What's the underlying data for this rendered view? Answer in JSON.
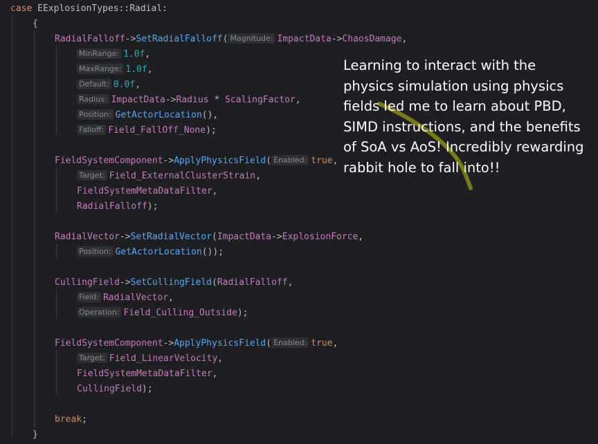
{
  "colors": {
    "background": "#1e1f22",
    "keyword": "#cf8e6d",
    "type": "#bcbec4",
    "field": "#c77dbb",
    "method": "#56a8f5",
    "number": "#2aacb8",
    "text": "#bcbec4",
    "hint_bg": "#2f3034",
    "hint_text": "#868a91",
    "overlay_text": "#ffffff"
  },
  "code_lines": [
    {
      "indent": 0,
      "tokens": [
        {
          "t": "case",
          "c": "kw"
        },
        {
          "t": " EExplosionTypes::Radial:",
          "c": "tx"
        }
      ]
    },
    {
      "indent": 1,
      "tokens": [
        {
          "t": "{",
          "c": "tx"
        }
      ]
    },
    {
      "indent": 2,
      "tokens": [
        {
          "t": "RadialFalloff",
          "c": "fl"
        },
        {
          "t": "->",
          "c": "tx"
        },
        {
          "t": "SetRadialFalloff",
          "c": "me"
        },
        {
          "t": "(",
          "c": "tx"
        },
        {
          "t": "Magnitude:",
          "c": "hint"
        },
        {
          "t": "ImpactData",
          "c": "fl"
        },
        {
          "t": "->",
          "c": "tx"
        },
        {
          "t": "ChaosDamage",
          "c": "fl"
        },
        {
          "t": ",",
          "c": "tx"
        }
      ]
    },
    {
      "indent": 3,
      "tokens": [
        {
          "t": "MinRange:",
          "c": "hint"
        },
        {
          "t": "1.0f",
          "c": "nu"
        },
        {
          "t": ",",
          "c": "tx"
        }
      ]
    },
    {
      "indent": 3,
      "tokens": [
        {
          "t": "MaxRange:",
          "c": "hint"
        },
        {
          "t": "1.0f",
          "c": "nu"
        },
        {
          "t": ",",
          "c": "tx"
        }
      ]
    },
    {
      "indent": 3,
      "tokens": [
        {
          "t": "Default:",
          "c": "hint"
        },
        {
          "t": "0.0f",
          "c": "nu"
        },
        {
          "t": ",",
          "c": "tx"
        }
      ]
    },
    {
      "indent": 3,
      "tokens": [
        {
          "t": "Radius:",
          "c": "hint"
        },
        {
          "t": "ImpactData",
          "c": "fl"
        },
        {
          "t": "->",
          "c": "tx"
        },
        {
          "t": "Radius",
          "c": "fl"
        },
        {
          "t": " * ",
          "c": "tx"
        },
        {
          "t": "ScalingFactor",
          "c": "fl"
        },
        {
          "t": ",",
          "c": "tx"
        }
      ]
    },
    {
      "indent": 3,
      "tokens": [
        {
          "t": "Position:",
          "c": "hint"
        },
        {
          "t": "GetActorLocation",
          "c": "me"
        },
        {
          "t": "(),",
          "c": "tx"
        }
      ]
    },
    {
      "indent": 3,
      "tokens": [
        {
          "t": "Falloff:",
          "c": "hint"
        },
        {
          "t": "Field_FallOff_None",
          "c": "fl"
        },
        {
          "t": ");",
          "c": "tx"
        }
      ]
    },
    {
      "indent": 0,
      "tokens": []
    },
    {
      "indent": 2,
      "tokens": [
        {
          "t": "FieldSystemComponent",
          "c": "fl"
        },
        {
          "t": "->",
          "c": "tx"
        },
        {
          "t": "ApplyPhysicsField",
          "c": "me"
        },
        {
          "t": "(",
          "c": "tx"
        },
        {
          "t": "Enabled:",
          "c": "hint"
        },
        {
          "t": "true",
          "c": "kw"
        },
        {
          "t": ",",
          "c": "tx"
        }
      ]
    },
    {
      "indent": 3,
      "tokens": [
        {
          "t": "Target:",
          "c": "hint"
        },
        {
          "t": "Field_ExternalClusterStrain",
          "c": "fl"
        },
        {
          "t": ",",
          "c": "tx"
        }
      ]
    },
    {
      "indent": 3,
      "tokens": [
        {
          "t": "FieldSystemMetaDataFilter",
          "c": "fl"
        },
        {
          "t": ",",
          "c": "tx"
        }
      ]
    },
    {
      "indent": 3,
      "tokens": [
        {
          "t": "RadialFalloff",
          "c": "fl"
        },
        {
          "t": ");",
          "c": "tx"
        }
      ]
    },
    {
      "indent": 0,
      "tokens": []
    },
    {
      "indent": 2,
      "tokens": [
        {
          "t": "RadialVector",
          "c": "fl"
        },
        {
          "t": "->",
          "c": "tx"
        },
        {
          "t": "SetRadialVector",
          "c": "me"
        },
        {
          "t": "(",
          "c": "tx"
        },
        {
          "t": "ImpactData",
          "c": "fl"
        },
        {
          "t": "->",
          "c": "tx"
        },
        {
          "t": "ExplosionForce",
          "c": "fl"
        },
        {
          "t": ",",
          "c": "tx"
        }
      ]
    },
    {
      "indent": 3,
      "tokens": [
        {
          "t": "Position:",
          "c": "hint"
        },
        {
          "t": "GetActorLocation",
          "c": "me"
        },
        {
          "t": "());",
          "c": "tx"
        }
      ]
    },
    {
      "indent": 0,
      "tokens": []
    },
    {
      "indent": 2,
      "tokens": [
        {
          "t": "CullingField",
          "c": "fl"
        },
        {
          "t": "->",
          "c": "tx"
        },
        {
          "t": "SetCullingField",
          "c": "me"
        },
        {
          "t": "(",
          "c": "tx"
        },
        {
          "t": "RadialFalloff",
          "c": "fl"
        },
        {
          "t": ",",
          "c": "tx"
        }
      ]
    },
    {
      "indent": 3,
      "tokens": [
        {
          "t": "Field:",
          "c": "hint"
        },
        {
          "t": "RadialVector",
          "c": "fl"
        },
        {
          "t": ",",
          "c": "tx"
        }
      ]
    },
    {
      "indent": 3,
      "tokens": [
        {
          "t": "Operation:",
          "c": "hint"
        },
        {
          "t": "Field_Culling_Outside",
          "c": "fl"
        },
        {
          "t": ");",
          "c": "tx"
        }
      ]
    },
    {
      "indent": 0,
      "tokens": []
    },
    {
      "indent": 2,
      "tokens": [
        {
          "t": "FieldSystemComponent",
          "c": "fl"
        },
        {
          "t": "->",
          "c": "tx"
        },
        {
          "t": "ApplyPhysicsField",
          "c": "me"
        },
        {
          "t": "(",
          "c": "tx"
        },
        {
          "t": "Enabled:",
          "c": "hint"
        },
        {
          "t": "true",
          "c": "kw"
        },
        {
          "t": ",",
          "c": "tx"
        }
      ]
    },
    {
      "indent": 3,
      "tokens": [
        {
          "t": "Target:",
          "c": "hint"
        },
        {
          "t": "Field_LinearVelocity",
          "c": "fl"
        },
        {
          "t": ",",
          "c": "tx"
        }
      ]
    },
    {
      "indent": 3,
      "tokens": [
        {
          "t": "FieldSystemMetaDataFilter",
          "c": "fl"
        },
        {
          "t": ",",
          "c": "tx"
        }
      ]
    },
    {
      "indent": 3,
      "tokens": [
        {
          "t": "CullingField",
          "c": "fl"
        },
        {
          "t": ");",
          "c": "tx"
        }
      ]
    },
    {
      "indent": 0,
      "tokens": []
    },
    {
      "indent": 2,
      "tokens": [
        {
          "t": "break",
          "c": "kw"
        },
        {
          "t": ";",
          "c": "tx"
        }
      ]
    },
    {
      "indent": 1,
      "tokens": [
        {
          "t": "}",
          "c": "tx"
        }
      ]
    }
  ],
  "overlay": {
    "lines": [
      "Learning to interact with the",
      "physics simulation using physics",
      "fields led me to learn about PBD,",
      "SIMD instructions, and the benefits",
      "of SoA vs AoS! Incredibly rewarding",
      "rabbit hole to fall into!!"
    ]
  }
}
